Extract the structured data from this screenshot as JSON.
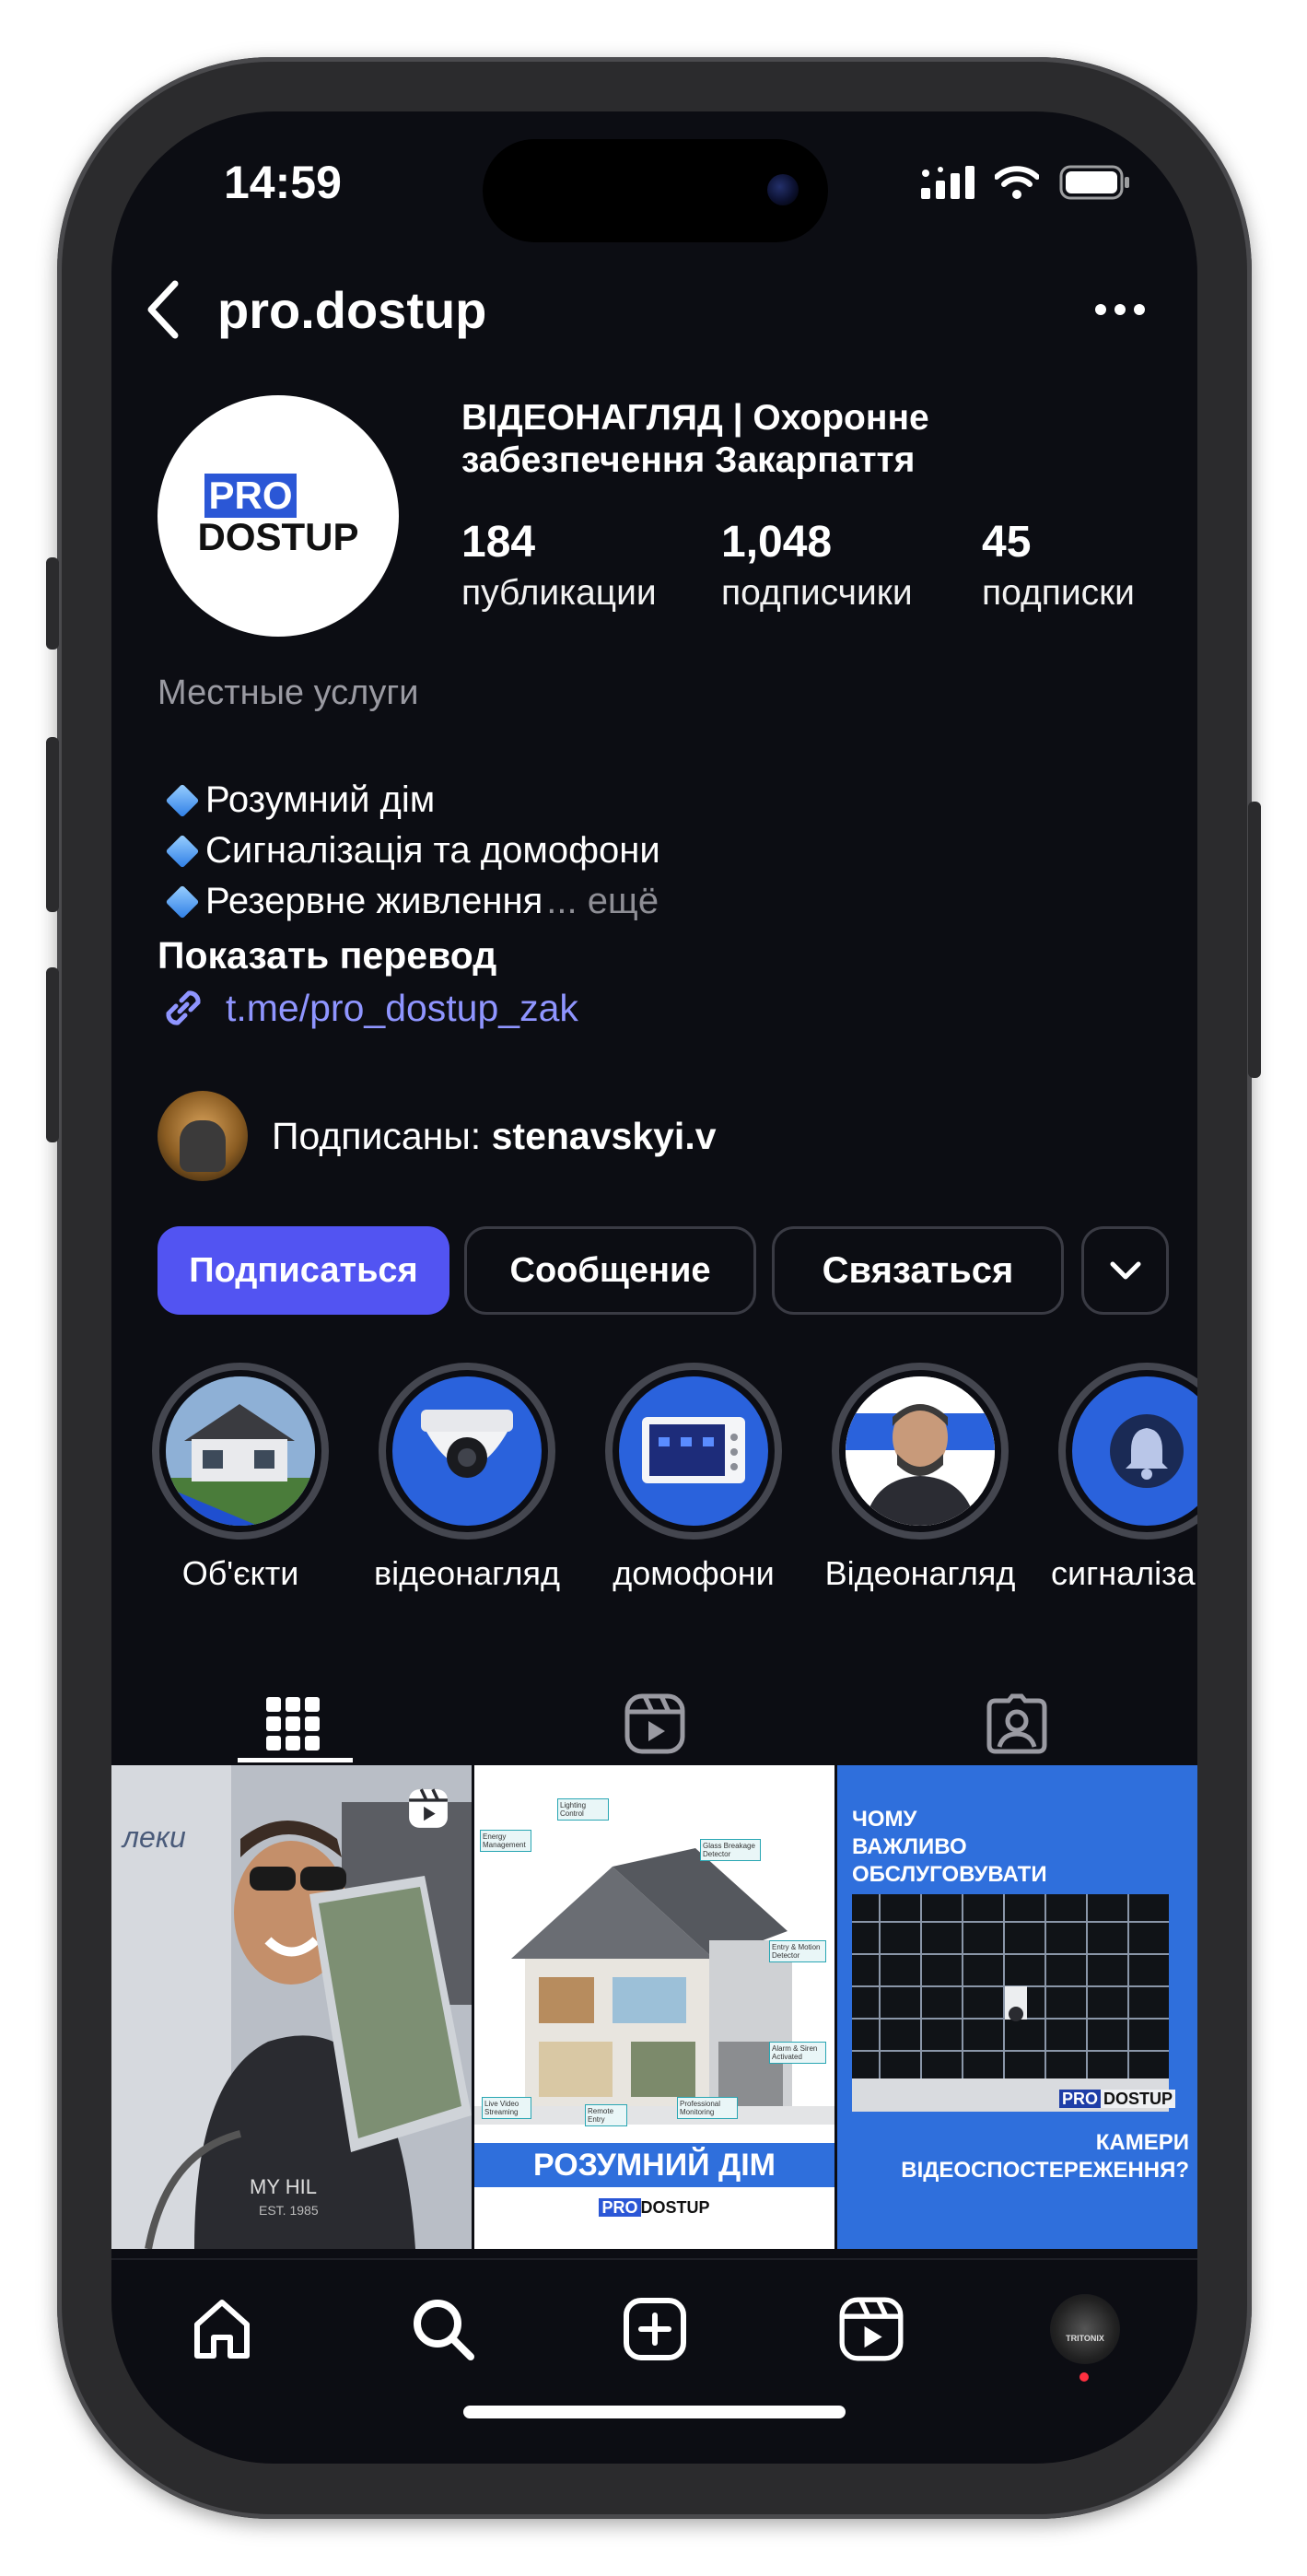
{
  "status_bar": {
    "time": "14:59"
  },
  "header": {
    "username": "pro.dostup"
  },
  "avatar_logo": {
    "line1": "PRO",
    "line2": "DOSTUP"
  },
  "profile": {
    "name_line1": "ВІДЕОНАГЛЯД | Охоронне",
    "name_line2": "забезпечення Закарпаття",
    "stats": [
      {
        "value": "184",
        "label": "публикации"
      },
      {
        "value": "1,048",
        "label": "подписчики"
      },
      {
        "value": "45",
        "label": "подписки"
      }
    ],
    "category": "Местные услуги",
    "bio": [
      "Розумний дім",
      "Сигналізація та домофони",
      "Резервне живлення"
    ],
    "more_label": "... ещё",
    "translate_label": "Показать перевод",
    "link": "t.me/pro_dostup_zak",
    "followed_prefix": "Подписаны:",
    "followed_user": "stenavskyi.v"
  },
  "actions": {
    "follow": "Подписаться",
    "message": "Сообщение",
    "contact": "Связаться"
  },
  "highlights": [
    {
      "label": "Об'єкти",
      "icon": "house-photo"
    },
    {
      "label": "відеонагляд",
      "icon": "dome-camera"
    },
    {
      "label": "домофони",
      "icon": "intercom-screen"
    },
    {
      "label": "Відеонагляд",
      "icon": "man-portrait"
    },
    {
      "label": "сигналіза",
      "icon": "bell-icon"
    }
  ],
  "posts": [
    {
      "type": "reel",
      "caption_text": "леки",
      "shirt_text": "MY HIL",
      "shirt_sub": "EST. 1985"
    },
    {
      "type": "image",
      "title": "РОЗУМНИЙ ДІМ",
      "logo_pro": "PRO",
      "logo_dostup": "DOSTUP",
      "labels": [
        "Energy Management",
        "Lighting Control",
        "Glass Breakage Detector",
        "Entry & Motion Detector",
        "Alarm & Siren Activated",
        "Professional Monitoring",
        "Remote Entry",
        "Live Video Streaming"
      ]
    },
    {
      "type": "image",
      "title_lines": [
        "ЧОМУ",
        "ВАЖЛИВО",
        "ОБСЛУГОВУВАТИ"
      ],
      "bottom_lines": [
        "КАМЕРИ",
        "ВІДЕОСПОСТЕРЕЖЕННЯ?"
      ],
      "logo_pro": "PRO",
      "logo_dostup": "DOSTUP"
    }
  ],
  "bottom_nav": [
    "home",
    "search",
    "create",
    "reels",
    "profile"
  ],
  "profile_thumb_text": "TRITONIX",
  "colors": {
    "accent": "#5254f2",
    "link": "#8f95ff",
    "background": "#0c0d13"
  }
}
